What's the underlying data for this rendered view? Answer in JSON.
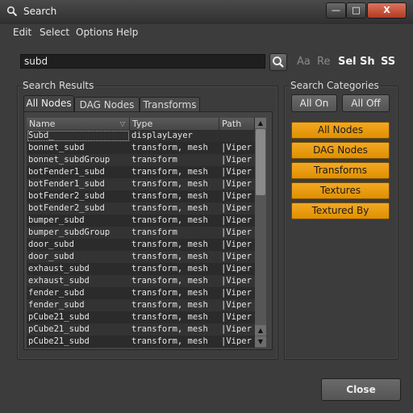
{
  "window": {
    "title": "Search",
    "controls": {
      "minimize": "—",
      "maximize": "□",
      "close": "X"
    }
  },
  "menu": [
    "Edit",
    "Select",
    "Options",
    "Help"
  ],
  "search": {
    "value": "subd",
    "options": [
      {
        "label": "Aa",
        "active": false
      },
      {
        "label": "Re",
        "active": false
      },
      {
        "label": "Sel",
        "active": true
      },
      {
        "label": "Sh",
        "active": true
      },
      {
        "label": "SS",
        "active": true
      }
    ]
  },
  "results": {
    "title": "Search Results",
    "tabs": [
      "All Nodes",
      "DAG Nodes",
      "Transforms"
    ],
    "active_tab": 0,
    "columns": [
      "Name",
      "Type",
      "Path"
    ],
    "rows": [
      {
        "name": "Subd_",
        "type": "displayLayer",
        "path": ""
      },
      {
        "name": "bonnet_subd",
        "type": "transform, mesh",
        "path": "|Viper|G"
      },
      {
        "name": "bonnet_subdGroup",
        "type": "transform",
        "path": "|Viper|G"
      },
      {
        "name": "botFender1_subd",
        "type": "transform, mesh",
        "path": "|Viper|S"
      },
      {
        "name": "botFender1_subd",
        "type": "transform, mesh",
        "path": "|Viper|S"
      },
      {
        "name": "botFender2_subd",
        "type": "transform, mesh",
        "path": "|Viper|S"
      },
      {
        "name": "botFender2_subd",
        "type": "transform, mesh",
        "path": "|Viper|S"
      },
      {
        "name": "bumper_subd",
        "type": "transform, mesh",
        "path": "|Viper|G"
      },
      {
        "name": "bumper_subdGroup",
        "type": "transform",
        "path": "|Viper|G"
      },
      {
        "name": "door_subd",
        "type": "transform, mesh",
        "path": "|Viper|S"
      },
      {
        "name": "door_subd",
        "type": "transform, mesh",
        "path": "|Viper|S"
      },
      {
        "name": "exhaust_subd",
        "type": "transform, mesh",
        "path": "|Viper|S"
      },
      {
        "name": "exhaust_subd",
        "type": "transform, mesh",
        "path": "|Viper|S"
      },
      {
        "name": "fender_subd",
        "type": "transform, mesh",
        "path": "|Viper|S"
      },
      {
        "name": "fender_subd",
        "type": "transform, mesh",
        "path": "|Viper|S"
      },
      {
        "name": "pCube21_subd",
        "type": "transform, mesh",
        "path": "|Viper|S"
      },
      {
        "name": "pCube21_subd",
        "type": "transform, mesh",
        "path": "|Viper|S"
      },
      {
        "name": "pCube21_subd",
        "type": "transform, mesh",
        "path": "|Viper|S"
      }
    ]
  },
  "categories": {
    "title": "Search Categories",
    "all_on": "All On",
    "all_off": "All Off",
    "items": [
      "All Nodes",
      "DAG Nodes",
      "Transforms",
      "Textures",
      "Textured By"
    ]
  },
  "close_label": "Close",
  "colors": {
    "accent": "#f0a020",
    "background": "#3c3c3c"
  },
  "icons": {
    "title": "search-icon",
    "search_button": "magnifier-icon"
  }
}
